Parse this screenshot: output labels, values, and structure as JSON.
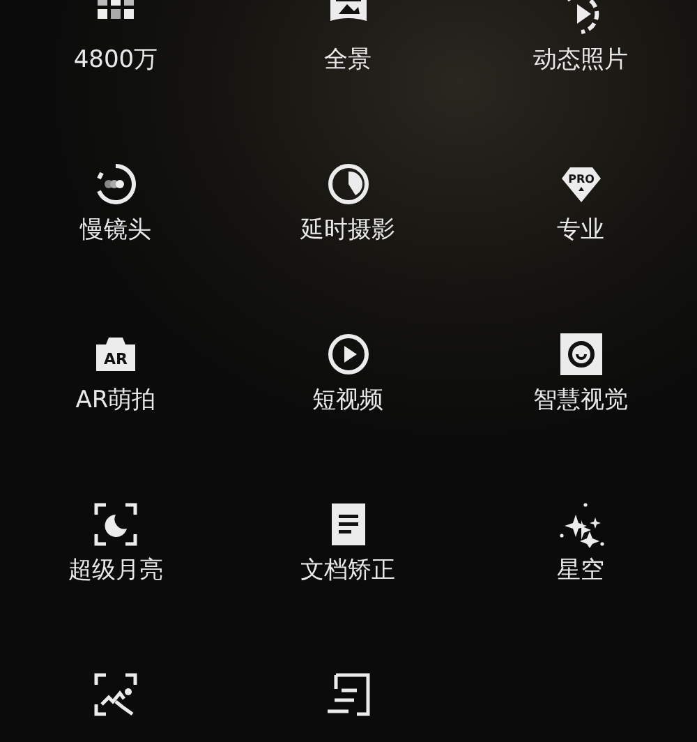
{
  "modes": [
    {
      "kind": "labeled",
      "label": "4800万"
    },
    {
      "kind": "labeled",
      "label": "全景"
    },
    {
      "kind": "labeled",
      "label": "动态照片"
    },
    {
      "kind": "labeled",
      "label": "慢镜头"
    },
    {
      "kind": "labeled",
      "label": "延时摄影"
    },
    {
      "kind": "labeled",
      "label": "专业",
      "icon_text": "PRO"
    },
    {
      "kind": "labeled",
      "label": "AR萌拍",
      "icon_text": "AR"
    },
    {
      "kind": "labeled",
      "label": "短视频"
    },
    {
      "kind": "labeled",
      "label": "智慧视觉"
    },
    {
      "kind": "labeled",
      "label": "超级月亮"
    },
    {
      "kind": "labeled",
      "label": "文档矫正"
    },
    {
      "kind": "labeled",
      "label": "星空"
    },
    {
      "kind": "icon_only"
    },
    {
      "kind": "icon_only"
    }
  ]
}
